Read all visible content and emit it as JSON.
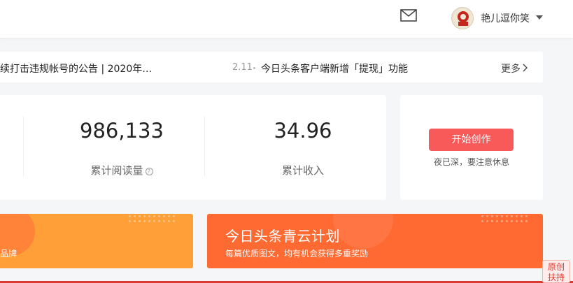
{
  "header": {
    "user_name": "艳儿逗你笑",
    "icons": {
      "mail": "mail-icon",
      "dropdown": "caret-down-icon",
      "avatar": "avatar"
    }
  },
  "notice": {
    "left_text": "续打击违规帐号的公告 | 2020年…",
    "date": "2.11",
    "right_text": "今日头条客户端新增「提现」功能",
    "more_label": "更多"
  },
  "stats": [
    {
      "value": "986,133",
      "label": "累计阅读量",
      "has_help": true
    },
    {
      "value": "34.96",
      "label": "累计收入",
      "has_help": false
    }
  ],
  "action": {
    "button_label": "开始创作",
    "hint": "夜已深，要注意休息"
  },
  "banners": {
    "left": {
      "text": "品牌"
    },
    "right": {
      "title": "今日头条青云计划",
      "subtitle": "每篇优质图文，均有机会获得多重奖励"
    }
  },
  "float_badge": {
    "line1": "原创",
    "line2": "扶持"
  },
  "colors": {
    "accent": "#f85959",
    "banner_left": "#ff9f37",
    "banner_right": "#ff6a33",
    "page_bg": "#f5f6f7"
  }
}
